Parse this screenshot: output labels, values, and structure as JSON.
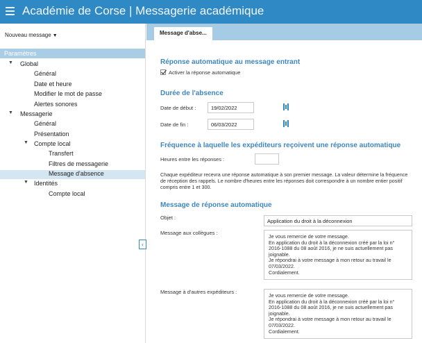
{
  "header": {
    "title": "Académie de Corse | Messagerie académique",
    "menu_icon": "hamburger-menu-icon"
  },
  "left": {
    "new_message": "Nouveau message",
    "params": "Paramètres",
    "tree": [
      {
        "label": "Global"
      },
      {
        "label": "Général"
      },
      {
        "label": "Date et heure"
      },
      {
        "label": "Modifier le mot de passe"
      },
      {
        "label": "Alertes sonores"
      },
      {
        "label": "Messagerie"
      },
      {
        "label": "Général"
      },
      {
        "label": "Présentation"
      },
      {
        "label": "Compte local"
      },
      {
        "label": "Transfert"
      },
      {
        "label": "Filtres de messagerie"
      },
      {
        "label": "Message d'absence"
      },
      {
        "label": "Identités"
      },
      {
        "label": "Compte local"
      }
    ],
    "collapse": "‹"
  },
  "tab": {
    "label": "Message d'abse..."
  },
  "auto_reply": {
    "title": "Réponse automatique au message entrant",
    "checkbox_label": "Activer la réponse automatique",
    "checked": true
  },
  "duration": {
    "title": "Durée de l'absence",
    "start_label": "Date de début :",
    "start_value": "19/02/2022",
    "end_label": "Date de fin :",
    "end_value": "06/03/2022"
  },
  "frequency": {
    "title": "Fréquence à laquelle les expéditeurs reçoivent une réponse automatique",
    "hours_label": "Heures entre les réponses :",
    "hours_value": "",
    "description": [
      "Chaque expéditeur recevra une réponse automatique à son premier message. La valeur détermine la fréquence",
      "de réception des rappels. Le nombre d'heures entre les réponses doit correspondre à un nombre entier positif",
      "compris entre 1 et 300."
    ]
  },
  "message": {
    "title": "Message de réponse automatique",
    "subject_label": "Objet :",
    "subject_value": "Application du droit à la déconnexion",
    "colleagues_label": "Message aux collègues :",
    "colleagues_lines": [
      "Je vous remercie de votre message.",
      "En application du droit à la déconnexion créé par la loi n°",
      "2016-1088 du 08 août 2016, je ne suis actuellement pas",
      "joignable.",
      "Je répondrai à votre message à mon retour au travail le",
      "07/03/2022.",
      "Cordialement."
    ],
    "others_label": "Message à d'autres expéditeurs :",
    "others_lines": [
      "Je vous remercie de votre message.",
      "En application du droit à la déconnexion créé par la loi n°",
      "2016-1088 du 08 août 2016, je ne suis actuellement pas",
      "joignable.",
      "Je répondrai à votre message à mon retour au travail le",
      "07/03/2022.",
      "Cordialement."
    ]
  },
  "colors": {
    "header": "#2f89c5",
    "section_title": "#3f86bf",
    "tab_bar": "#a6cbe5",
    "selected": "#d5e6f3"
  }
}
